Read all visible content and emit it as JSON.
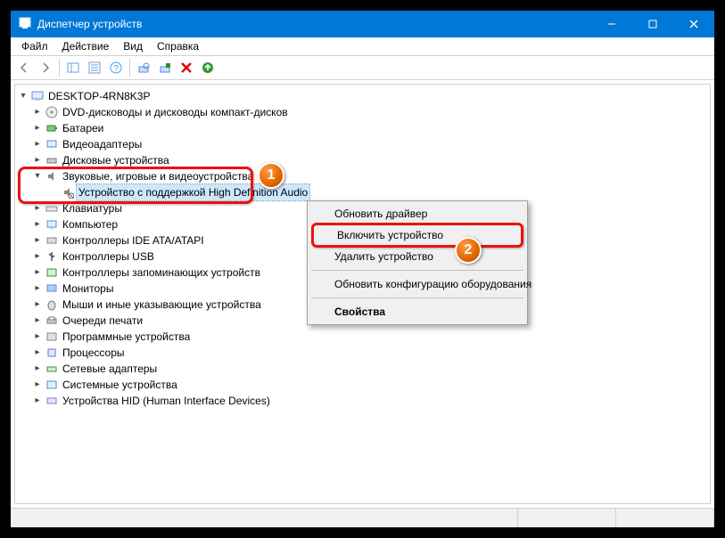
{
  "window": {
    "title": "Диспетчер устройств"
  },
  "menu": {
    "file": "Файл",
    "action": "Действие",
    "view": "Вид",
    "help": "Справка"
  },
  "root": {
    "label": "DESKTOP-4RN8K3P"
  },
  "nodes": [
    {
      "label": "DVD-дисководы и дисководы компакт-дисков"
    },
    {
      "label": "Батареи"
    },
    {
      "label": "Видеоадаптеры"
    },
    {
      "label": "Дисковые устройства"
    },
    {
      "label": "Звуковые, игровые и видеоустройства"
    },
    {
      "label": "Устройство с поддержкой High Definition Audio"
    },
    {
      "label": "Клавиатуры"
    },
    {
      "label": "Компьютер"
    },
    {
      "label": "Контроллеры IDE ATA/ATAPI"
    },
    {
      "label": "Контроллеры USB"
    },
    {
      "label": "Контроллеры запоминающих устройств"
    },
    {
      "label": "Мониторы"
    },
    {
      "label": "Мыши и иные указывающие устройства"
    },
    {
      "label": "Очереди печати"
    },
    {
      "label": "Программные устройства"
    },
    {
      "label": "Процессоры"
    },
    {
      "label": "Сетевые адаптеры"
    },
    {
      "label": "Системные устройства"
    },
    {
      "label": "Устройства HID (Human Interface Devices)"
    }
  ],
  "ctx": {
    "update": "Обновить драйвер",
    "enable": "Включить устройство",
    "remove": "Удалить устройство",
    "rescan": "Обновить конфигурацию оборудования",
    "props": "Свойства"
  },
  "badges": {
    "one": "1",
    "two": "2"
  }
}
